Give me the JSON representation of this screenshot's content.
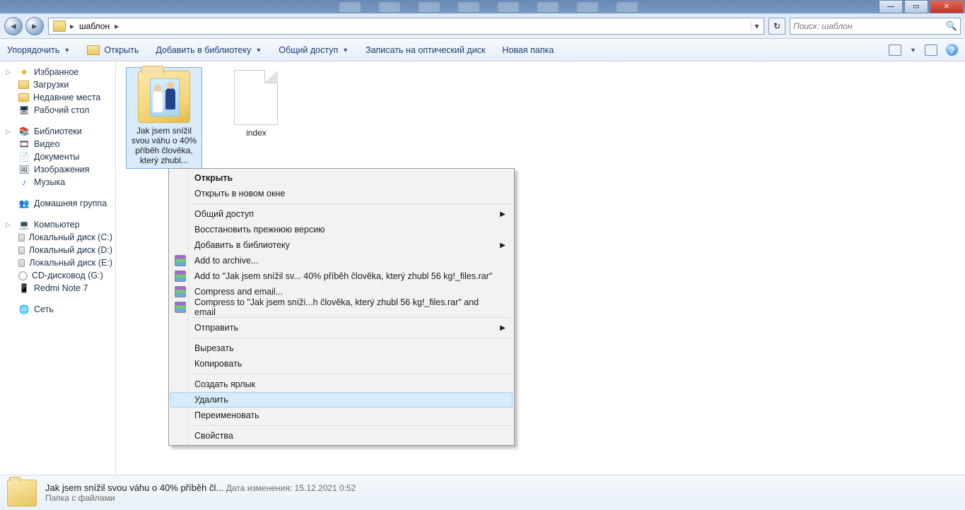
{
  "titlebar": {
    "minimize_glyph": "—",
    "maximize_glyph": "▭",
    "close_glyph": "✕"
  },
  "nav": {
    "back_glyph": "◄",
    "forward_glyph": "►",
    "crumb_sep": "▸",
    "crumb1": "шаблон",
    "dropdown_glyph": "▾",
    "refresh_glyph": "↻"
  },
  "search": {
    "placeholder": "Поиск: шаблон",
    "icon_glyph": "🔍"
  },
  "toolbar": {
    "organize": "Упорядочить",
    "open": "Открыть",
    "add_library": "Добавить в библиотеку",
    "share": "Общий доступ",
    "burn": "Записать на оптический диск",
    "new_folder": "Новая папка",
    "help_glyph": "?"
  },
  "sidebar": {
    "favorites": "Избранное",
    "downloads": "Загрузки",
    "recent": "Недавние места",
    "desktop": "Рабочий стол",
    "libraries": "Библиотеки",
    "video": "Видео",
    "documents": "Документы",
    "pictures": "Изображения",
    "music": "Музыка",
    "homegroup": "Домашняя группа",
    "computer": "Компьютер",
    "driveC": "Локальный диск (C:)",
    "driveD": "Локальный диск (D:)",
    "driveE": "Локальный диск (E:)",
    "driveG": "CD-дисковод (G:)",
    "redmi": "Redmi Note 7",
    "network": "Сеть"
  },
  "items": {
    "folder_name": "Jak jsem snížil svou váhu o 40% příběh člověka, který zhubl...",
    "file_name": "index"
  },
  "contextmenu": {
    "open": "Открыть",
    "open_new": "Открыть в новом окне",
    "share": "Общий доступ",
    "restore": "Восстановить прежнюю версию",
    "add_library": "Добавить в библиотеку",
    "add_archive": "Add to archive...",
    "add_to_rar": "Add to \"Jak jsem snížil sv... 40% příběh člověka, který zhubl 56 kg!_files.rar\"",
    "compress_email": "Compress and email...",
    "compress_to": "Compress to \"Jak jsem sníži...h člověka, který zhubl 56 kg!_files.rar\" and email",
    "send_to": "Отправить",
    "cut": "Вырезать",
    "copy": "Копировать",
    "shortcut": "Создать ярлык",
    "delete": "Удалить",
    "rename": "Переименовать",
    "properties": "Свойства"
  },
  "details": {
    "name": "Jak jsem snížil svou váhu o 40% příběh čl...",
    "date_label": "Дата изменения:",
    "date_value": "15.12.2021 0:52",
    "type": "Папка с файлами"
  }
}
